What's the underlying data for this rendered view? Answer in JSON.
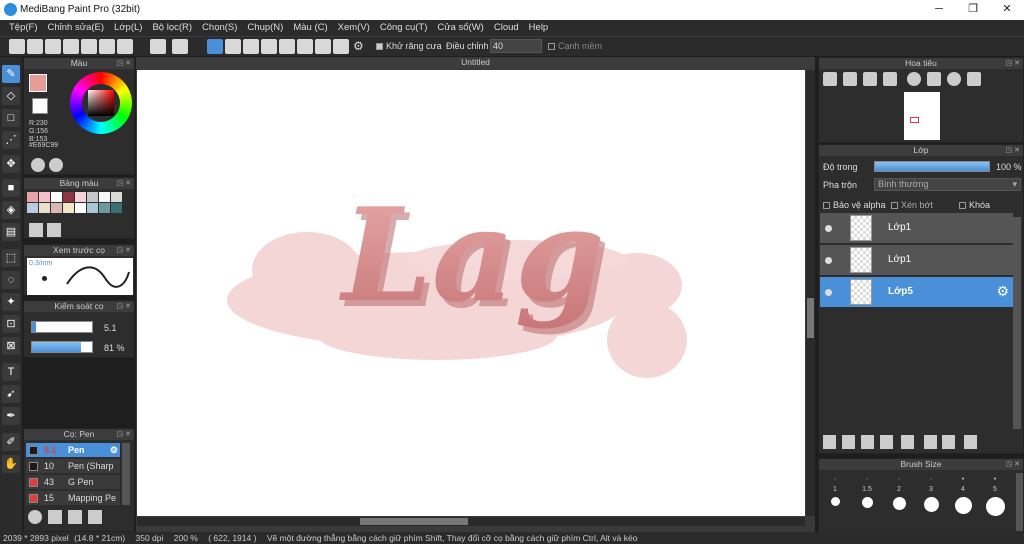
{
  "app": {
    "title": "MediBang Paint Pro (32bit)"
  },
  "menu": [
    "Tệp(F)",
    "Chỉnh sửa(E)",
    "Lớp(L)",
    "Bộ lọc(R)",
    "Chọn(S)",
    "Chụp(N)",
    "Màu (C)",
    "Xem(V)",
    "Công cụ(T)",
    "Cửa sổ(W)",
    "Cloud",
    "Help"
  ],
  "toolbar": {
    "antialias_label": "Khử răng cưa",
    "adjust_label": "Điều chỉnh",
    "adjust_value": "40",
    "edge_label": "Cạnh mềm"
  },
  "color_panel": {
    "title": "Màu",
    "r": "R:230",
    "g": "G:156",
    "b": "B:153",
    "hex": "#E69C99",
    "fg": "#E69C99"
  },
  "palette_panel": {
    "title": "Bảng màu",
    "colors": [
      "#e9a2a5",
      "#f2c0c6",
      "#ffffff",
      "#8e3545",
      "#f5d3d8",
      "#c6c6c6",
      "#f7f7f7",
      "#d8d8d8",
      "#b8cbe0",
      "#e8e0c8",
      "#d9b9b1",
      "#f2e6c4",
      "#ffffff",
      "#a7c7d6",
      "#6b9b9e",
      "#3c6d72"
    ]
  },
  "brush_preview": {
    "title": "Xem trước cọ",
    "size_label": "0.3/mm"
  },
  "brush_control": {
    "title": "Kiểm soát cọ",
    "size": "5.1",
    "opacity": "81 %",
    "opacity_fraction": 0.81
  },
  "brush_panel": {
    "title": "Cọ: Pen",
    "items": [
      {
        "size": "5.1",
        "name": "Pen",
        "color": "#1a1a1a"
      },
      {
        "size": "10",
        "name": "Pen (Sharp",
        "color": "#1a1a1a"
      },
      {
        "size": "43",
        "name": "G Pen",
        "color": "#e23b3b"
      },
      {
        "size": "15",
        "name": "Mapping Pe",
        "color": "#e23b3b"
      }
    ]
  },
  "canvas": {
    "tab": "Untitled",
    "text": "Lag"
  },
  "navigator": {
    "title": "Hoa tiêu"
  },
  "layer_panel": {
    "title": "Lớp",
    "opacity_label": "Độ trong",
    "opacity_value": "100 %",
    "opacity_fraction": 1.0,
    "blend_label": "Pha trộn",
    "blend_value": "Bình thường",
    "protect_alpha": "Bảo vệ alpha",
    "clipping": "Xén bớt",
    "lock": "Khóa",
    "layers": [
      {
        "name": "Lớp1"
      },
      {
        "name": "Lớp1"
      },
      {
        "name": "Lớp5"
      }
    ]
  },
  "brush_size_panel": {
    "title": "Brush Size",
    "sizes": [
      "1",
      "1.5",
      "2",
      "3",
      "4",
      "5"
    ]
  },
  "status": {
    "pixels": "2039 * 2893 pixel",
    "mm": "(14.8 * 21cm)",
    "dpi": "350 dpi",
    "zoom": "200 %",
    "coord": "( 622, 1914 )",
    "hint": "Vẽ một đường thẳng bằng cách giữ phím Shift, Thay đổi cỡ cọ bằng cách giữ phím Ctrl, Alt và kéo"
  },
  "colors": {
    "accent": "#4a90d9",
    "panel": "#2d2d2d"
  }
}
